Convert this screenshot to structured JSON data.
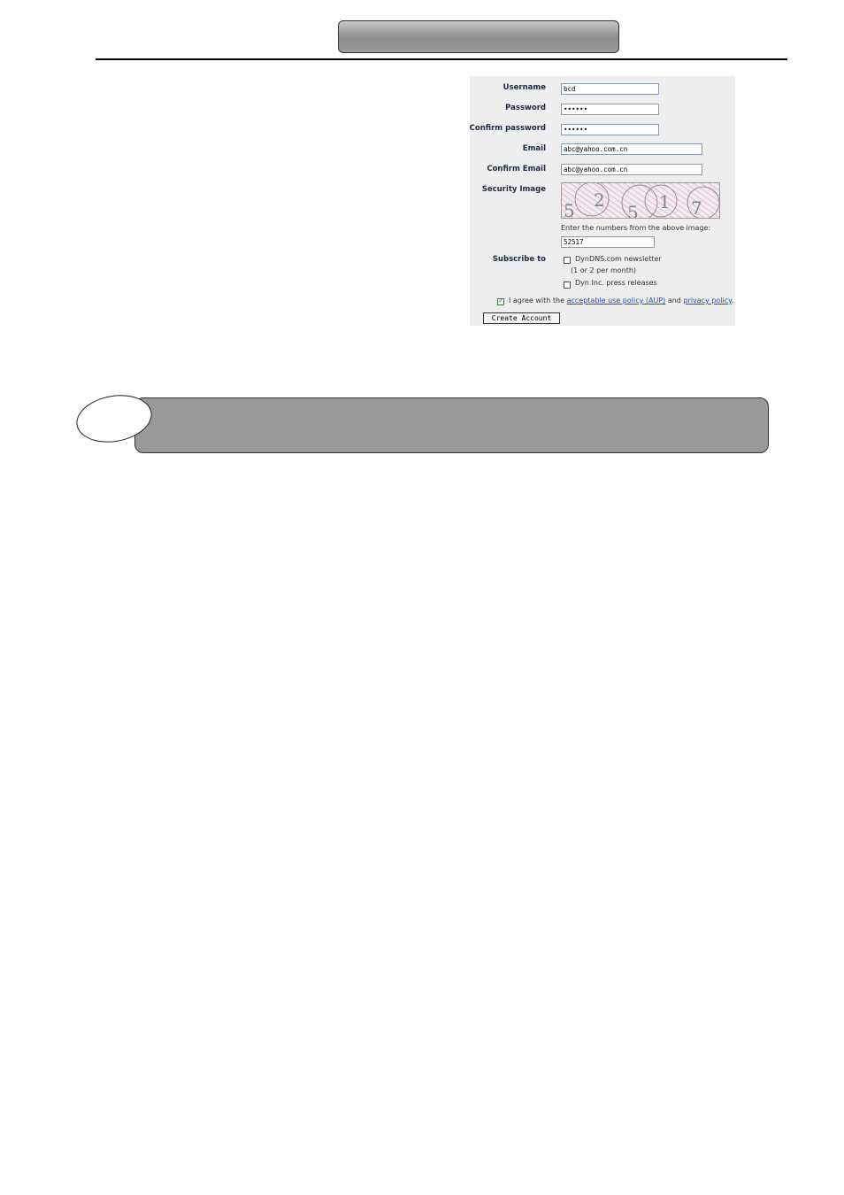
{
  "form": {
    "username_label": "Username",
    "username_value": "bcd",
    "password_label": "Password",
    "password_value": "••••••",
    "confirm_password_label": "Confirm password",
    "confirm_password_value": "••••••",
    "email_label": "Email",
    "email_value": "abc@yahoo.com.cn",
    "confirm_email_label": "Confirm Email",
    "confirm_email_value": "abc@yahoo.com.cn",
    "security_label": "Security Image",
    "captcha_digits": [
      "5",
      "2",
      "5",
      "1",
      "7"
    ],
    "captcha_hint": "Enter the numbers from the above image:",
    "captcha_value": "52517",
    "subscribe_label": "Subscribe to",
    "newsletter_label": "DynDNS.com newsletter",
    "newsletter_sub": "(1 or 2 per month)",
    "newsletter_checked": false,
    "press_label": "Dyn Inc. press releases",
    "press_checked": false,
    "agree_checked": true,
    "agree_prefix": "I agree with the",
    "aup_link": "acceptable use policy (AUP)",
    "agree_and": "and",
    "privacy_link": "privacy policy",
    "agree_suffix": ".",
    "create_button": "Create Account"
  }
}
